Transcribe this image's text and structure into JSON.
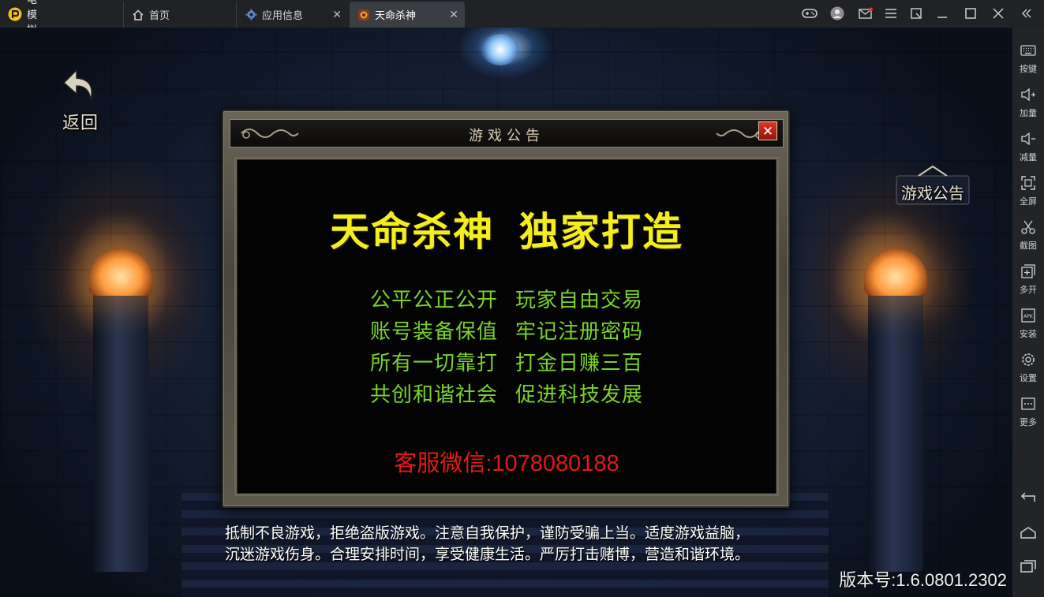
{
  "titlebar": {
    "app_name": "雷电模拟器",
    "tabs": [
      {
        "label": "首页",
        "icon": "home-icon"
      },
      {
        "label": "应用信息",
        "icon": "gear-icon"
      },
      {
        "label": "天命杀神",
        "icon": "game-icon",
        "active": true
      }
    ],
    "controls": [
      "gamepad-icon",
      "user-icon",
      "mail-icon",
      "menu-icon",
      "restore-icon",
      "minimize-icon",
      "maximize-icon",
      "close-icon"
    ]
  },
  "sidebar": {
    "items": [
      {
        "label": "按键",
        "icon": "keyboard-icon"
      },
      {
        "label": "加量",
        "icon": "volume-up-icon"
      },
      {
        "label": "减量",
        "icon": "volume-down-icon"
      },
      {
        "label": "全屏",
        "icon": "fullscreen-icon"
      },
      {
        "label": "截图",
        "icon": "scissors-icon"
      },
      {
        "label": "多开",
        "icon": "multi-instance-icon"
      },
      {
        "label": "安装",
        "icon": "apk-icon"
      },
      {
        "label": "设置",
        "icon": "settings-icon"
      },
      {
        "label": "更多",
        "icon": "more-icon"
      }
    ],
    "bottom": [
      "back-icon",
      "home-icon",
      "recent-apps-icon"
    ]
  },
  "game": {
    "back_label": "返回",
    "notice_label": "游戏公告",
    "dialog": {
      "title": "游戏公告",
      "headline": "天命杀神  独家打造",
      "slogans": [
        [
          "公平公正公开",
          "玩家自由交易"
        ],
        [
          "账号装备保值",
          "牢记注册密码"
        ],
        [
          "所有一切靠打",
          "打金日赚三百"
        ],
        [
          "共创和谐社会",
          "促进科技发展"
        ]
      ],
      "contact": "客服微信:1078080188"
    },
    "warning_line1": "抵制不良游戏，拒绝盗版游戏。注意自我保护，谨防受骗上当。适度游戏益脑，",
    "warning_line2": "沉迷游戏伤身。合理安排时间，享受健康生活。严厉打击赌博，营造和谐环境。",
    "version": "版本号:1.6.0801.2302"
  },
  "colors": {
    "headline": "#f5ee1e",
    "slogan": "#7ad22a",
    "contact": "#e31a14",
    "titlebar_bg": "#202225",
    "sidebar_bg": "#222427"
  }
}
